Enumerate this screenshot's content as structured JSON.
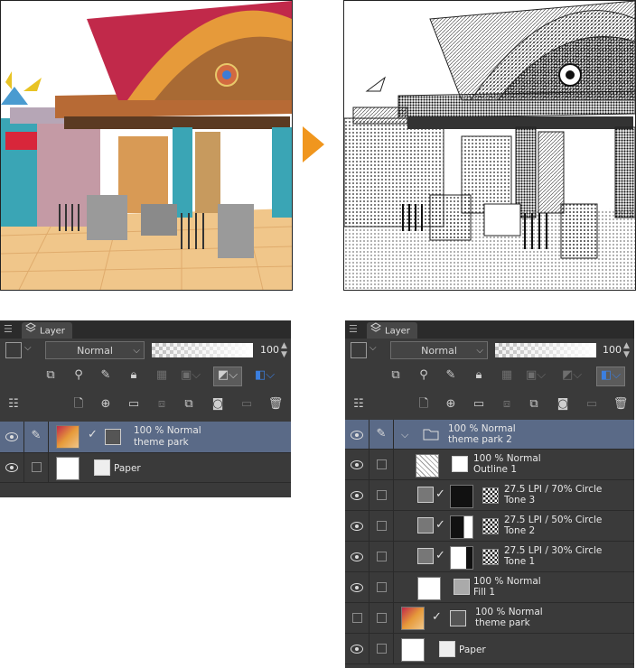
{
  "arrow_color": "#f0961e",
  "left_panel": {
    "tab_label": "Layer",
    "blend_mode": "Normal",
    "opacity": "100",
    "layers": [
      {
        "name_line1": "100 % Normal",
        "name_line2": "theme park",
        "selected": true
      },
      {
        "name_line1": "Paper",
        "name_line2": "",
        "selected": false
      }
    ]
  },
  "right_panel": {
    "tab_label": "Layer",
    "blend_mode": "Normal",
    "opacity": "100",
    "layers": [
      {
        "name_line1": "100 % Normal",
        "name_line2": "theme park 2",
        "type": "folder",
        "selected": true
      },
      {
        "name_line1": "100 % Normal",
        "name_line2": "Outline 1",
        "type": "outline"
      },
      {
        "name_line1": "27.5 LPI / 70% Circle",
        "name_line2": "Tone 3",
        "type": "tone"
      },
      {
        "name_line1": "27.5 LPI / 50% Circle",
        "name_line2": "Tone 2",
        "type": "tone"
      },
      {
        "name_line1": "27.5 LPI / 30% Circle",
        "name_line2": "Tone 1",
        "type": "tone"
      },
      {
        "name_line1": "100 % Normal",
        "name_line2": "Fill 1",
        "type": "fill"
      },
      {
        "name_line1": "100 % Normal",
        "name_line2": "theme park",
        "type": "raster"
      },
      {
        "name_line1": "Paper",
        "name_line2": "",
        "type": "paper"
      }
    ]
  }
}
